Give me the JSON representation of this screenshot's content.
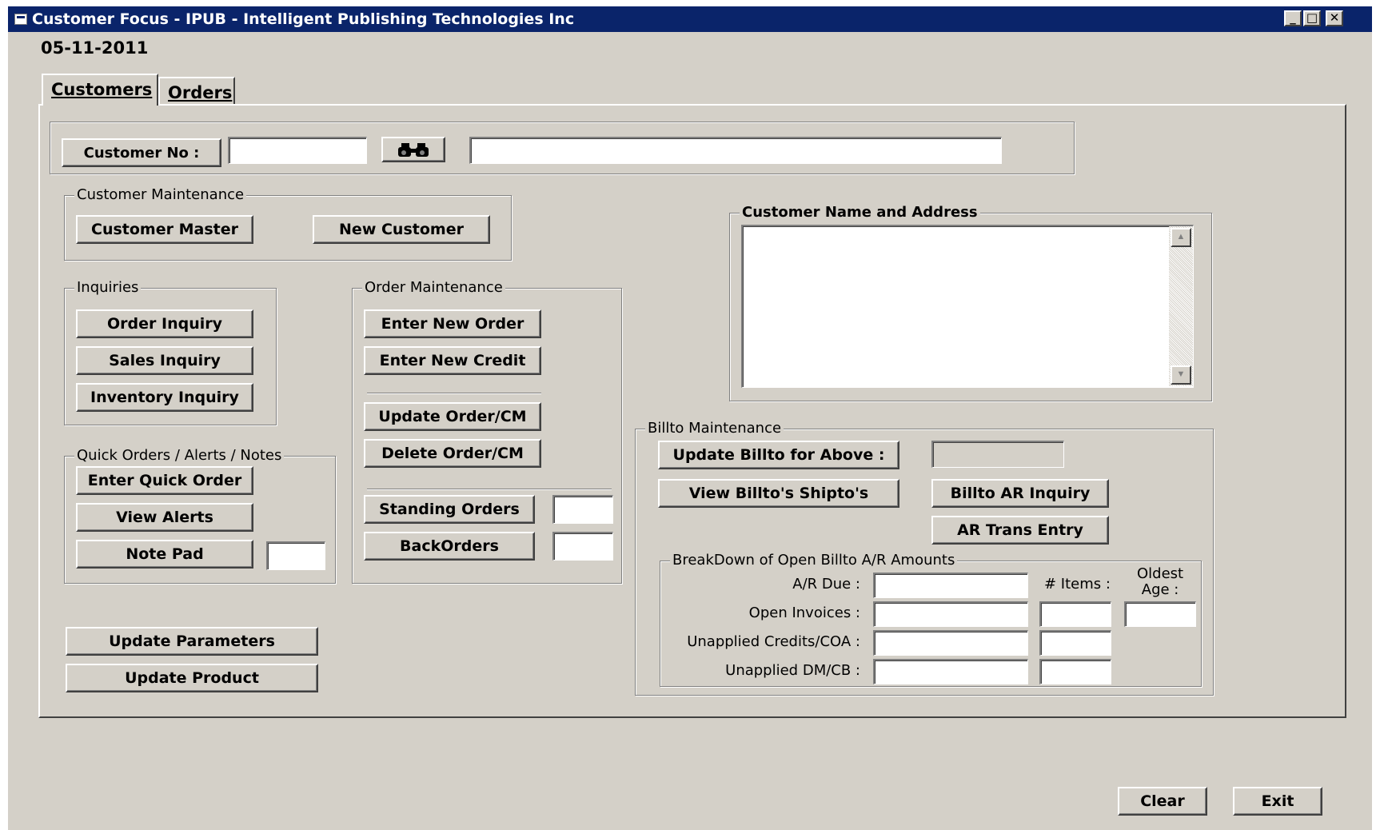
{
  "window": {
    "title": "Customer Focus - IPUB - Intelligent Publishing Technologies  Inc",
    "minimize": "_",
    "maximize": "□",
    "close": "✕"
  },
  "date": "05-11-2011",
  "tabs": [
    "Customers",
    "Orders"
  ],
  "customer_search": {
    "label": "Customer  No :",
    "number_value": "",
    "name_value": "",
    "search_icon": "binoculars-icon"
  },
  "customer_maintenance": {
    "title": "Customer Maintenance",
    "buttons": [
      "Customer Master",
      "New Customer"
    ]
  },
  "inquiries": {
    "title": "Inquiries",
    "buttons": [
      "Order Inquiry",
      "Sales Inquiry",
      "Inventory Inquiry"
    ]
  },
  "quick_orders": {
    "title": "Quick Orders / Alerts / Notes",
    "buttons": [
      "Enter Quick Order",
      "View Alerts",
      "Note Pad"
    ]
  },
  "order_maintenance": {
    "title": "Order  Maintenance",
    "buttons": [
      "Enter New Order",
      "Enter New Credit",
      "Update Order/CM",
      "Delete Order/CM",
      "Standing Orders",
      "BackOrders"
    ]
  },
  "customer_address": {
    "title": "Customer Name and Address",
    "value": ""
  },
  "billto": {
    "title": "Billto Maintenance",
    "update_button": "Update Billto for Above :",
    "view_shipto_button": "View Billto's Shipto's",
    "ar_inquiry_button": "Billto AR Inquiry",
    "ar_trans_button": "AR Trans Entry",
    "breakdown": {
      "title": "BreakDown of Open Billto A/R Amounts",
      "rows": [
        "A/R Due :",
        "Open Invoices :",
        "Unapplied Credits/COA :",
        "Unapplied DM/CB :"
      ],
      "items_label": "# Items :",
      "oldest_age_label": "Oldest\nAge :"
    }
  },
  "bottom_buttons": [
    "Update Parameters",
    "Update Product"
  ],
  "footer_buttons": [
    "Clear",
    "Exit"
  ]
}
